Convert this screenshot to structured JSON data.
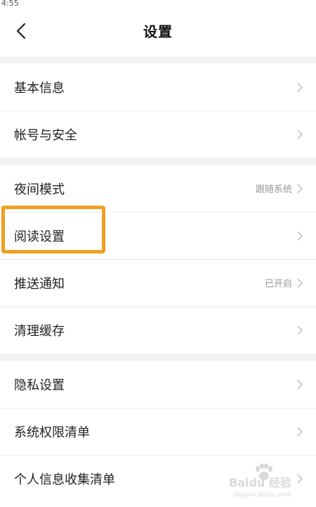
{
  "status_bar": {
    "time": "4:55"
  },
  "header": {
    "title": "设置"
  },
  "sections": [
    {
      "items": [
        {
          "label": "基本信息",
          "value": ""
        },
        {
          "label": "帐号与安全",
          "value": ""
        }
      ]
    },
    {
      "items": [
        {
          "label": "夜间模式",
          "value": "跟随系统"
        },
        {
          "label": "阅读设置",
          "value": ""
        },
        {
          "label": "推送通知",
          "value": "已开启"
        },
        {
          "label": "清理缓存",
          "value": ""
        }
      ]
    },
    {
      "items": [
        {
          "label": "隐私设置",
          "value": ""
        },
        {
          "label": "系统权限清单",
          "value": ""
        },
        {
          "label": "个人信息收集清单",
          "value": ""
        }
      ]
    }
  ],
  "watermark": {
    "text": "Baidu 经验",
    "sub": "jingyan.baidu.com"
  },
  "colors": {
    "highlight": "#f0a020",
    "section_gap": "#f2f2f2"
  }
}
